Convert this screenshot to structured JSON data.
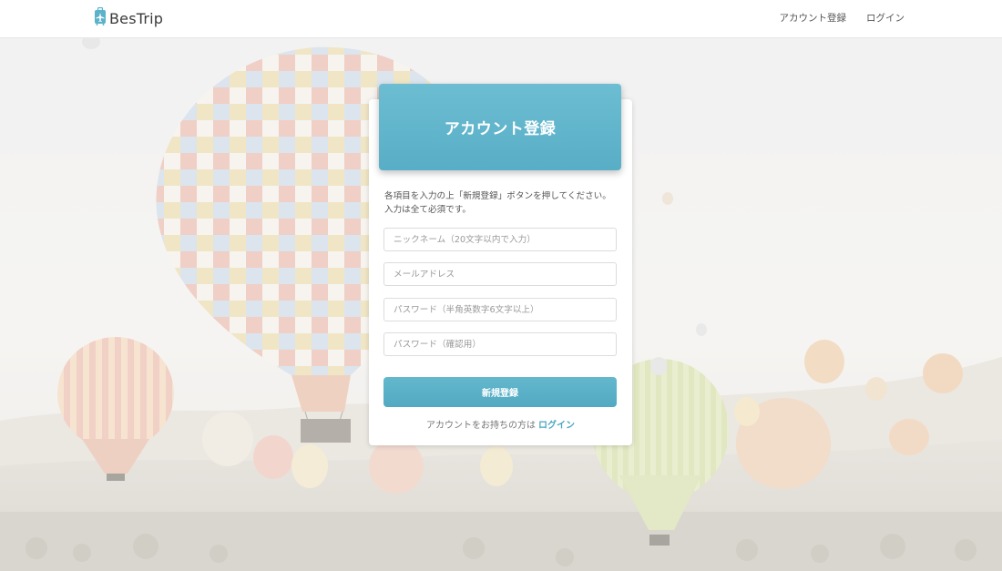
{
  "app": {
    "name": "BesTrip"
  },
  "nav": {
    "signup_label": "アカウント登録",
    "login_label": "ログイン"
  },
  "form": {
    "title": "アカウント登録",
    "instructions_line1": "各項目を入力の上「新規登録」ボタンを押してください。",
    "instructions_line2": "入力は全て必須です。",
    "nickname_placeholder": "ニックネーム（20文字以内で入力）",
    "email_placeholder": "メールアドレス",
    "password_placeholder": "パスワード（半角英数字6文字以上）",
    "password_confirm_placeholder": "パスワード（確認用）",
    "submit_label": "新規登録",
    "existing_account_text": "アカウントをお持ちの方は",
    "login_link_label": "ログイン"
  },
  "colors": {
    "accent": "#5cb2c9",
    "link": "#4aa6c0"
  },
  "icons": {
    "logo": "suitcase-airplane-icon"
  }
}
